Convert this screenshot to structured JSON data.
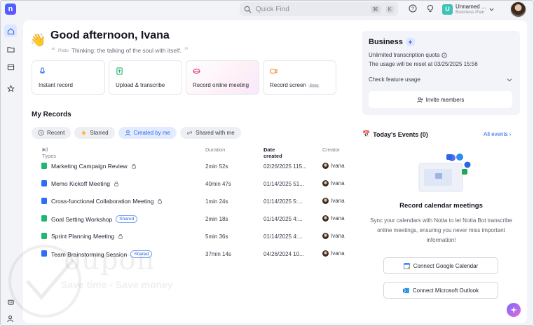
{
  "topbar": {
    "logo_letter": "n",
    "search_placeholder": "Quick Find",
    "shortcut_keys": [
      "⌘",
      "K"
    ],
    "user_initial": "U",
    "user_name": "Unnamed ...",
    "user_plan": "Business Plan"
  },
  "greeting": {
    "title": "Good afternoon, Ivana",
    "quote_author": "Plato",
    "quote_text": "Thinking: the talking of the soul with itself."
  },
  "actions": [
    {
      "label": "Instant record",
      "icon": "microphone-icon",
      "color": "#2f6df6"
    },
    {
      "label": "Upload & transcribe",
      "icon": "upload-file-icon",
      "color": "#22b573"
    },
    {
      "label": "Record online meeting",
      "icon": "meeting-lips-icon",
      "color": "#e3397a"
    },
    {
      "label": "Record screen",
      "icon": "screen-record-icon",
      "color": "#f08a24",
      "badge": "Beta"
    }
  ],
  "my_records": {
    "title": "My Records",
    "filters": [
      {
        "label": "Recent",
        "icon": "clock-icon"
      },
      {
        "label": "Starred",
        "icon": "star-icon"
      },
      {
        "label": "Created by me",
        "icon": "user-icon",
        "selected": true
      },
      {
        "label": "Shared with me",
        "icon": "link-icon"
      }
    ],
    "columns": {
      "type": "All Types",
      "duration": "Duration",
      "date": "Date created",
      "creator": "Creator"
    },
    "rows": [
      {
        "title": "Marketing Campaign Review",
        "duration": "2min 52s",
        "date": "02/26/2025 115...",
        "creator": "Ivana",
        "kind": "upload",
        "badge": "lock"
      },
      {
        "title": "Memo Kickoff Meeting",
        "duration": "40min 47s",
        "date": "01/14/2025 51...",
        "creator": "Ivana",
        "kind": "record",
        "badge": "lock"
      },
      {
        "title": "Cross-functional Collaboration Meeting",
        "duration": "1min 24s",
        "date": "01/14/2025 5:...",
        "creator": "Ivana",
        "kind": "record",
        "badge": "lock"
      },
      {
        "title": "Goal Setting Workshop",
        "duration": "2min 18s",
        "date": "01/14/2025 4:...",
        "creator": "Ivana",
        "kind": "upload",
        "badge": "Shared"
      },
      {
        "title": "Sprint Planning Meeting",
        "duration": "5min 36s",
        "date": "01/14/2025 4:...",
        "creator": "Ivana",
        "kind": "upload",
        "badge": "lock"
      },
      {
        "title": "Team Brainstorming Session",
        "duration": "37min 14s",
        "date": "04/26/2024 10...",
        "creator": "Ivana",
        "kind": "record",
        "badge": "Shared"
      }
    ]
  },
  "business": {
    "title": "Business",
    "quota": "Unlimited transcription quota",
    "reset": "The usage will be reset at 03/25/2025 15:56",
    "check_usage": "Check feature usage",
    "invite": "Invite members"
  },
  "events": {
    "emoji": "📅",
    "title": "Today's Events (0)",
    "all_link": "All events",
    "heading": "Record calendar meetings",
    "description": "Sync your calendars with Notta to let Notta Bot transcribe online meetings, ensuring you never miss important information!",
    "google_button": "Connect Google Calendar",
    "outlook_button": "Connect Microsoft Outlook"
  },
  "watermark": {
    "text": "oupon",
    "subtext": "Save time - Save money"
  },
  "colors": {
    "accent": "#2a66e8",
    "upload_green": "#22b573",
    "record_blue": "#2f6df6"
  }
}
